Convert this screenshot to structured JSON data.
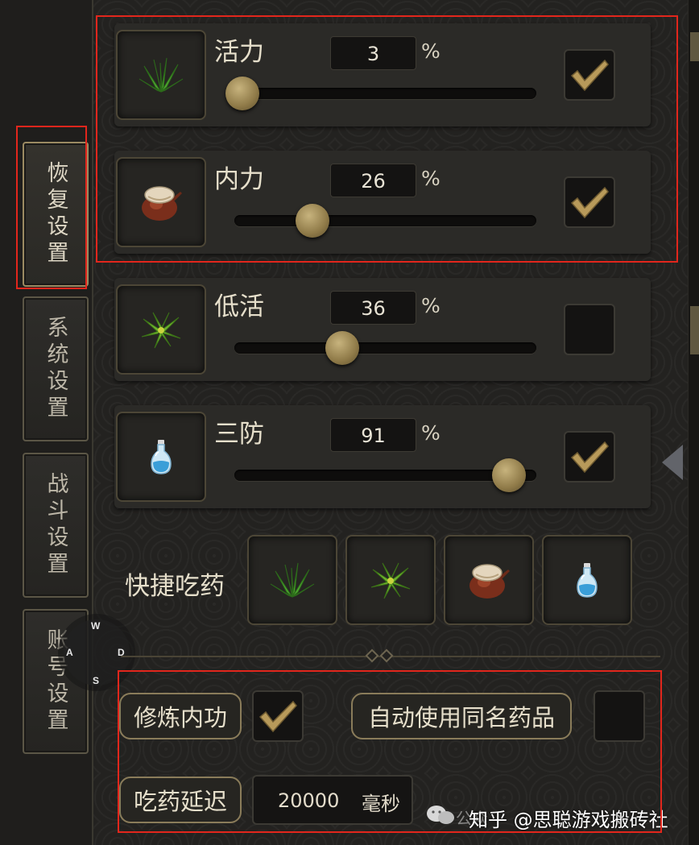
{
  "tabs": [
    {
      "label": "恢复设置",
      "active": true
    },
    {
      "label": "系统设置",
      "active": false
    },
    {
      "label": "战斗设置",
      "active": false
    },
    {
      "label": "账号设置",
      "active": false
    }
  ],
  "rows": [
    {
      "label": "活力",
      "value": "3",
      "unit": "%",
      "checked": true,
      "icon": "green-grass-herb-icon"
    },
    {
      "label": "内力",
      "value": "26",
      "unit": "%",
      "checked": true,
      "icon": "clay-pot-icon"
    },
    {
      "label": "低活",
      "value": "36",
      "unit": "%",
      "checked": false,
      "icon": "green-leaf-herb-icon"
    },
    {
      "label": "三防",
      "value": "91",
      "unit": "%",
      "checked": true,
      "icon": "blue-potion-bottle-icon"
    }
  ],
  "quick": {
    "label": "快捷吃药",
    "slots": [
      "green-grass-herb-icon",
      "green-leaf-herb-icon",
      "clay-pot-icon",
      "blue-potion-bottle-icon"
    ]
  },
  "options": {
    "cultivate_label": "修炼内功",
    "cultivate_checked": true,
    "auto_use_label": "自动使用同名药品",
    "auto_use_checked": false,
    "delay_label": "吃药延迟",
    "delay_value": "20000",
    "delay_unit": "毫秒"
  },
  "compass": {
    "n": "W",
    "w": "A",
    "e": "D",
    "s": "S"
  },
  "watermark": {
    "faded": "公众",
    "text": "知乎 @思聪游戏搬砖社"
  },
  "colors": {
    "highlight_border": "#e2261c",
    "knob": "#a89160",
    "check": "#b89a5a"
  }
}
